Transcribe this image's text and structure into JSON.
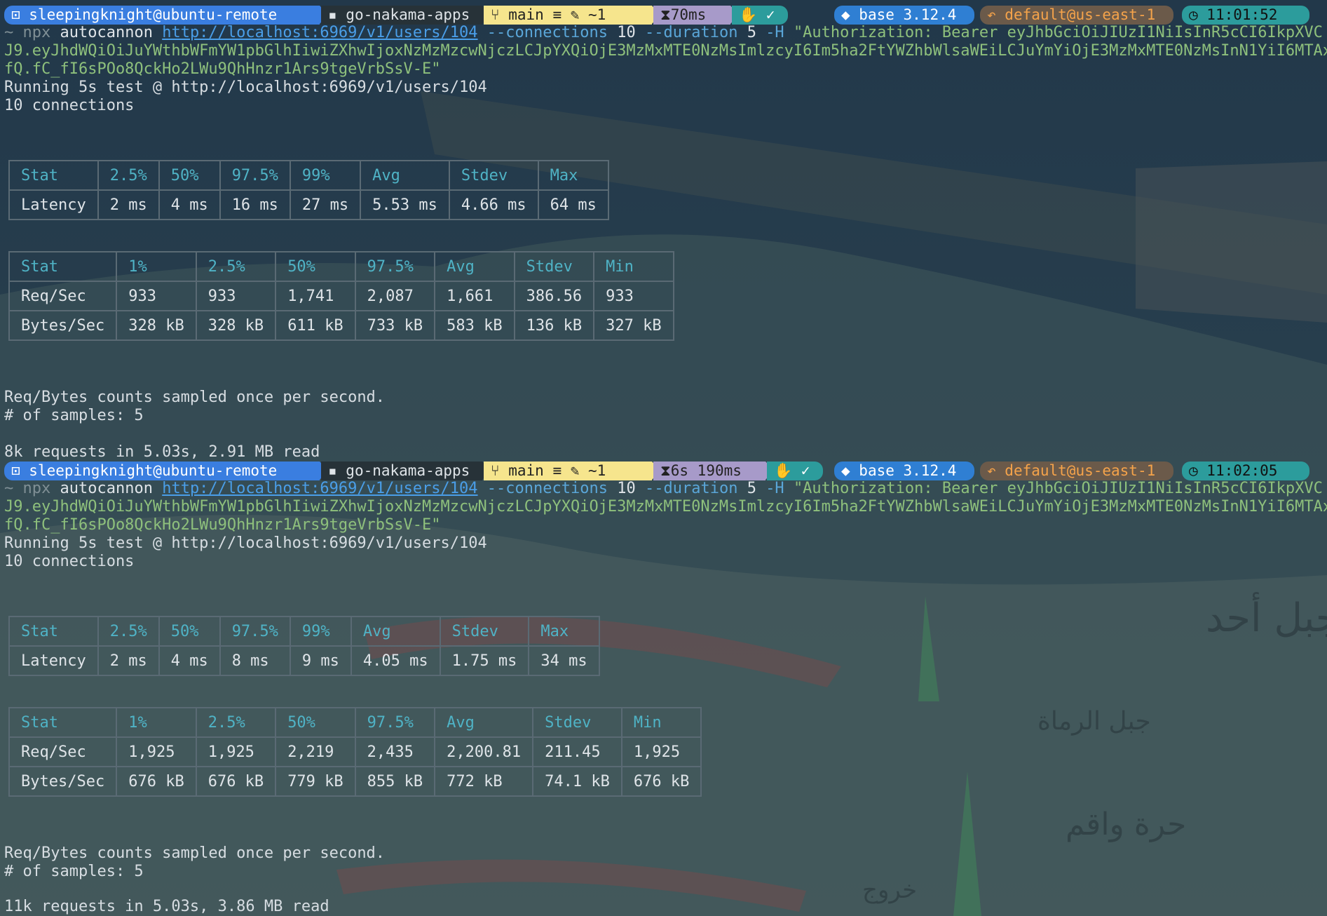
{
  "prompt1": {
    "user": "sleepingknight@ubuntu-remote",
    "dir": "go-nakama-apps",
    "git": "main ≡ ✎ ~1",
    "duration": "70ms",
    "status": "✓",
    "python": "base 3.12.4",
    "aws": "default@us-east-1",
    "clock": "11:01:52"
  },
  "prompt2": {
    "user": "sleepingknight@ubuntu-remote",
    "dir": "go-nakama-apps",
    "git": "main ≡ ✎ ~1",
    "duration": "6s 190ms",
    "status": "✓",
    "python": "base 3.12.4",
    "aws": "default@us-east-1",
    "clock": "11:02:05"
  },
  "command": {
    "tilde": "~",
    "npx": "npx",
    "tool": "autocannon",
    "url": "http://localhost:6969/v1/users/104",
    "conn_flag": "--connections",
    "conn_val": "10",
    "dur_flag": "--duration",
    "dur_val": "5",
    "h_flag": "-H",
    "header_start": "\"Authorization: Bearer eyJhbGciOiJIUzI1NiIsInR5cCI6IkpXVC",
    "header_mid": "J9.eyJhdWQiOiJuYWthbWFmYW1pbGlhIiwiZXhwIjoxNzMzMzcwNjczLCJpYXQiOjE3MzMxMTE0NzMsImlzcyI6Im5ha2FtYWZhbWlsaWEiLCJuYmYiOjE3MzMxMTE0NzMsInN1YiI6MTAx",
    "header_end": "fQ.fC_fI6sPOo8QckHo2LWu9QhHnzr1Ars9tgeVrbSsV-E\""
  },
  "run1": {
    "running": "Running 5s test @ http://localhost:6969/v1/users/104",
    "connections": "10 connections",
    "latency": {
      "headers": [
        "Stat",
        "2.5%",
        "50%",
        "97.5%",
        "99%",
        "Avg",
        "Stdev",
        "Max"
      ],
      "row": [
        "Latency",
        "2 ms",
        "4 ms",
        "16 ms",
        "27 ms",
        "5.53 ms",
        "4.66 ms",
        "64 ms"
      ]
    },
    "throughput": {
      "headers": [
        "Stat",
        "1%",
        "2.5%",
        "50%",
        "97.5%",
        "Avg",
        "Stdev",
        "Min"
      ],
      "rows": [
        [
          "Req/Sec",
          "933",
          "933",
          "1,741",
          "2,087",
          "1,661",
          "386.56",
          "933"
        ],
        [
          "Bytes/Sec",
          "328 kB",
          "328 kB",
          "611 kB",
          "733 kB",
          "583 kB",
          "136 kB",
          "327 kB"
        ]
      ]
    },
    "sampled": "Req/Bytes counts sampled once per second.",
    "samples": "# of samples: 5",
    "summary": "8k requests in 5.03s, 2.91 MB read"
  },
  "run2": {
    "running": "Running 5s test @ http://localhost:6969/v1/users/104",
    "connections": "10 connections",
    "latency": {
      "headers": [
        "Stat",
        "2.5%",
        "50%",
        "97.5%",
        "99%",
        "Avg",
        "Stdev",
        "Max"
      ],
      "row": [
        "Latency",
        "2 ms",
        "4 ms",
        "8 ms",
        "9 ms",
        "4.05 ms",
        "1.75 ms",
        "34 ms"
      ]
    },
    "throughput": {
      "headers": [
        "Stat",
        "1%",
        "2.5%",
        "50%",
        "97.5%",
        "Avg",
        "Stdev",
        "Min"
      ],
      "rows": [
        [
          "Req/Sec",
          "1,925",
          "1,925",
          "2,219",
          "2,435",
          "2,200.81",
          "211.45",
          "1,925"
        ],
        [
          "Bytes/Sec",
          "676 kB",
          "676 kB",
          "779 kB",
          "855 kB",
          "772 kB",
          "74.1 kB",
          "676 kB"
        ]
      ]
    },
    "sampled": "Req/Bytes counts sampled once per second.",
    "samples": "# of samples: 5",
    "summary": "11k requests in 5.03s, 3.86 MB read"
  },
  "background": {
    "label1": "جبل أحد",
    "label2": "جبل الرماة",
    "label3": "حرة واقم",
    "label4": "خروج",
    "colors": [
      "#2a3e4a",
      "#3d5560",
      "#5b6f72",
      "#7c4a4a"
    ]
  }
}
